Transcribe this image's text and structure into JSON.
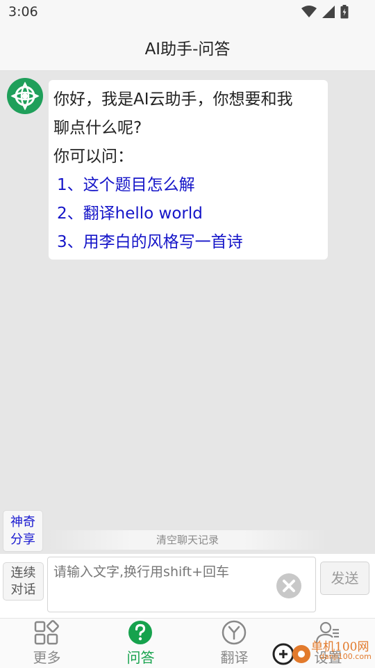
{
  "status": {
    "time": "3:06"
  },
  "header": {
    "title": "AI助手-问答"
  },
  "chat": {
    "greeting_line1": "你好，我是AI云助手，你想要和我",
    "greeting_line2": "聊点什么呢?",
    "prompt": "你可以问：",
    "suggestions": [
      "1、这个题目怎么解",
      "2、翻译hello world",
      "3、用李白的风格写一首诗"
    ]
  },
  "magic_share": {
    "line1": "神奇",
    "line2": "分享"
  },
  "clear_history": "清空聊天记录",
  "input": {
    "continuous_line1": "连续",
    "continuous_line2": "对话",
    "placeholder": "请输入文字,换行用shift+回车",
    "send": "发送"
  },
  "nav": [
    {
      "label": "更多",
      "icon": "grid-icon"
    },
    {
      "label": "问答",
      "icon": "question-icon"
    },
    {
      "label": "翻译",
      "icon": "translate-y-icon"
    },
    {
      "label": "设置",
      "icon": "user-settings-icon"
    }
  ],
  "watermark": {
    "line1": "单机100网",
    "line2": "danji100.com"
  },
  "colors": {
    "accent": "#16a24d",
    "link": "#1414c8",
    "watermark": "#e27a2c"
  }
}
